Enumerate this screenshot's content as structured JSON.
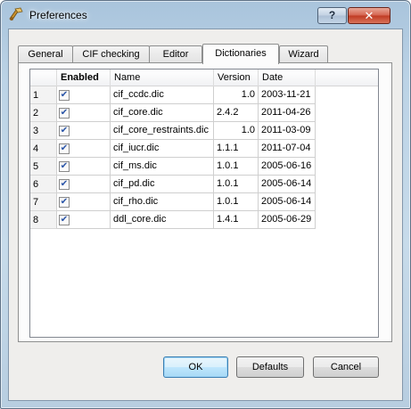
{
  "window": {
    "title": "Preferences",
    "help_label": "?",
    "close_label": "✕"
  },
  "tabs": [
    {
      "label": "General",
      "active": false
    },
    {
      "label": "CIF checking",
      "active": false
    },
    {
      "label": "Editor",
      "active": false
    },
    {
      "label": "Dictionaries",
      "active": true
    },
    {
      "label": "Wizard",
      "active": false
    }
  ],
  "table": {
    "columns": {
      "enabled": "Enabled",
      "name": "Name",
      "version": "Version",
      "date": "Date"
    },
    "rows": [
      {
        "num": "1",
        "enabled": true,
        "name": "cif_ccdc.dic",
        "version": "1.0",
        "date": "2003-11-21"
      },
      {
        "num": "2",
        "enabled": true,
        "name": "cif_core.dic",
        "version": "2.4.2",
        "date": "2011-04-26"
      },
      {
        "num": "3",
        "enabled": true,
        "name": "cif_core_restraints.dic",
        "version": "1.0",
        "date": "2011-03-09"
      },
      {
        "num": "4",
        "enabled": true,
        "name": "cif_iucr.dic",
        "version": "1.1.1",
        "date": "2011-07-04"
      },
      {
        "num": "5",
        "enabled": true,
        "name": "cif_ms.dic",
        "version": "1.0.1",
        "date": "2005-06-16"
      },
      {
        "num": "6",
        "enabled": true,
        "name": "cif_pd.dic",
        "version": "1.0.1",
        "date": "2005-06-14"
      },
      {
        "num": "7",
        "enabled": true,
        "name": "cif_rho.dic",
        "version": "1.0.1",
        "date": "2005-06-14"
      },
      {
        "num": "8",
        "enabled": true,
        "name": "ddl_core.dic",
        "version": "1.4.1",
        "date": "2005-06-29"
      }
    ],
    "check_glyph": "✔"
  },
  "buttons": {
    "ok": "OK",
    "defaults": "Defaults",
    "cancel": "Cancel"
  },
  "colors": {
    "title_bar": "#bcd3e6",
    "close_button": "#c03a22",
    "default_button": "#bee6fd"
  }
}
